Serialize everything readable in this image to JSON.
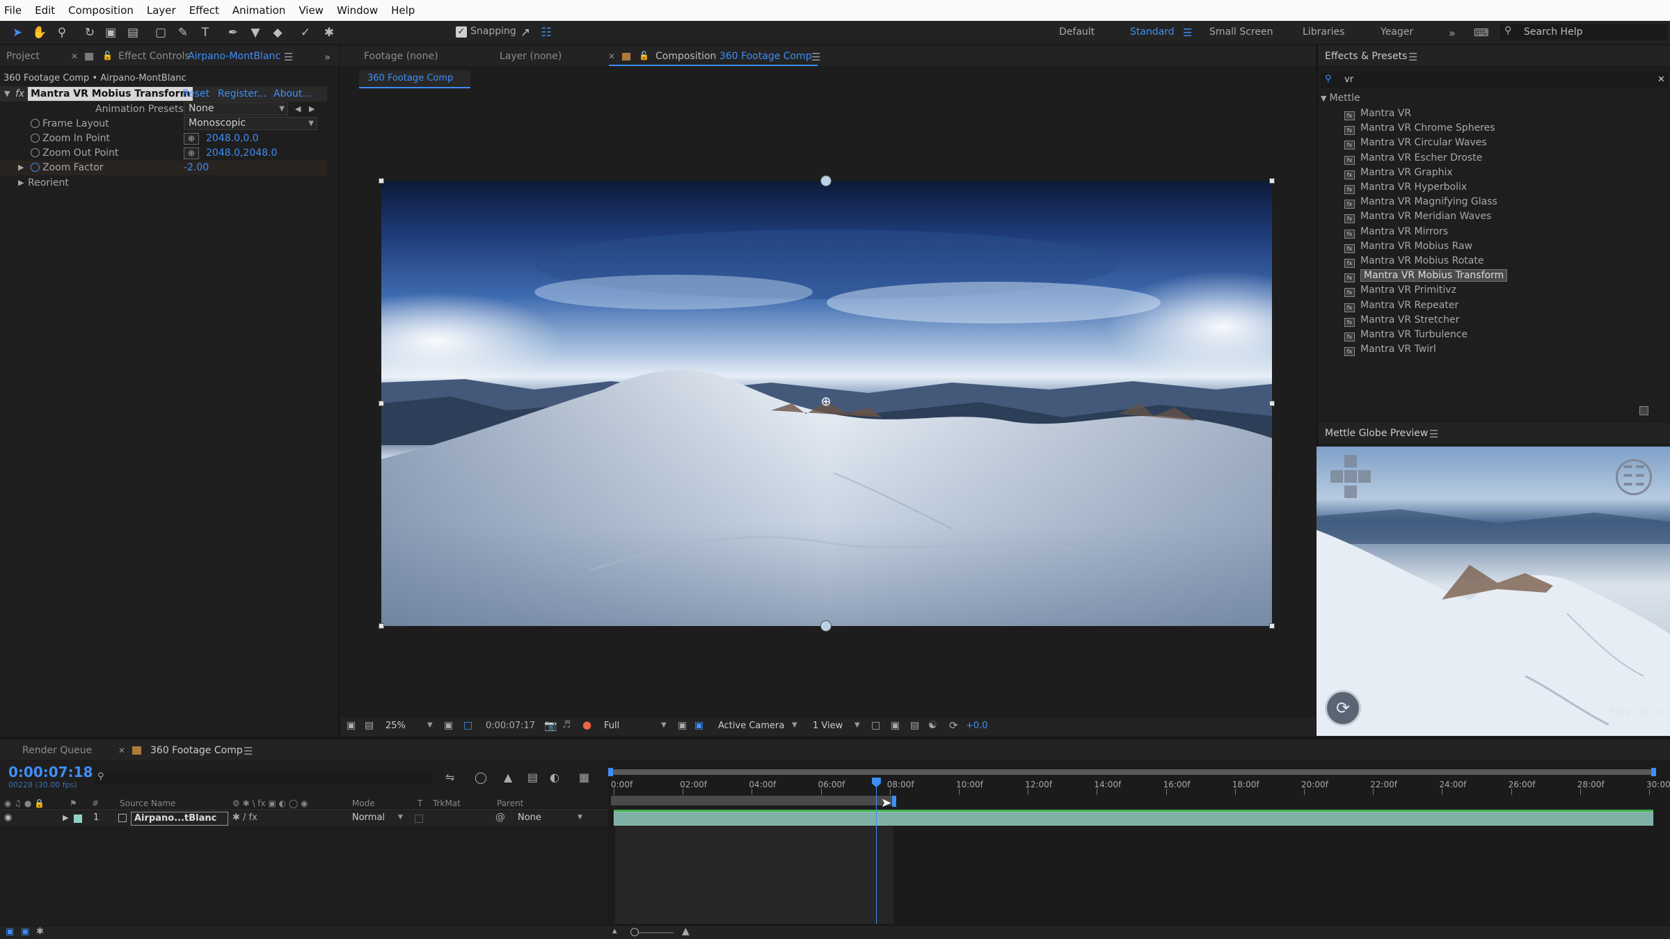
{
  "menu": [
    "File",
    "Edit",
    "Composition",
    "Layer",
    "Effect",
    "Animation",
    "View",
    "Window",
    "Help"
  ],
  "toolbar": {
    "snapping_label": "Snapping",
    "workspaces": [
      "Default",
      "Standard",
      "Small Screen",
      "Libraries",
      "Yeager"
    ],
    "active_workspace": "Standard",
    "search_placeholder": "Search Help"
  },
  "left_panel": {
    "tab_project": "Project",
    "tab_effect_controls": "Effect Controls",
    "layer_name": "Airpano-MontBlanc",
    "breadcrumb": "360 Footage Comp • Airpano-MontBlanc",
    "effect_name": "Mantra VR Mobius Transform",
    "reset": "Reset",
    "register": "Register...",
    "about": "About...",
    "animation_presets_label": "Animation Presets:",
    "animation_presets_value": "None",
    "frame_layout_label": "Frame Layout",
    "frame_layout_value": "Monoscopic",
    "zoom_in_label": "Zoom In Point",
    "zoom_in_value": "2048.0,0.0",
    "zoom_out_label": "Zoom Out Point",
    "zoom_out_value": "2048.0,2048.0",
    "zoom_factor_label": "Zoom Factor",
    "zoom_factor_value": "-2.00",
    "reorient_label": "Reorient"
  },
  "viewer": {
    "tab_footage": "Footage (none)",
    "tab_layer": "Layer (none)",
    "tab_composition_prefix": "Composition",
    "comp_name": "360 Footage Comp",
    "subtab": "360 Footage Comp",
    "zoom": "25%",
    "timecode": "0:00:07:17",
    "resolution": "Full",
    "camera": "Active Camera",
    "views": "1 View",
    "exposure": "+0.0"
  },
  "effects_presets": {
    "title": "Effects & Presets",
    "search_value": "vr",
    "category": "Mettle",
    "items": [
      "Mantra VR",
      "Mantra VR Chrome Spheres",
      "Mantra VR Circular Waves",
      "Mantra VR Escher Droste",
      "Mantra VR Graphix",
      "Mantra VR Hyperbolix",
      "Mantra VR Magnifying Glass",
      "Mantra VR Meridian Waves",
      "Mantra VR Mirrors",
      "Mantra VR Mobius Raw",
      "Mantra VR Mobius Rotate",
      "Mantra VR Mobius Transform",
      "Mantra VR Primitivz",
      "Mantra VR Repeater",
      "Mantra VR Stretcher",
      "Mantra VR Turbulence",
      "Mantra VR Twirl"
    ],
    "selected_item": "Mantra VR Mobius Transform"
  },
  "globe_preview": {
    "title": "Mettle Globe Preview",
    "fov": "FOV: 90.0"
  },
  "timeline": {
    "tab_render_queue": "Render Queue",
    "tab_comp": "360 Footage Comp",
    "timecode": "0:00:07:18",
    "frame_info": "00228 (30.00 fps)",
    "columns": {
      "source_name": "Source Name",
      "mode": "Mode",
      "t": "T",
      "trkmat": "TrkMat",
      "parent": "Parent"
    },
    "layer": {
      "number": "1",
      "name": "Airpano...tBlanc",
      "mode": "Normal",
      "parent": "None"
    },
    "ruler_labels": [
      "0:00f",
      "02:00f",
      "04:00f",
      "06:00f",
      "08:00f",
      "10:00f",
      "12:00f",
      "14:00f",
      "16:00f",
      "18:00f",
      "20:00f",
      "22:00f",
      "24:00f",
      "26:00f",
      "28:00f",
      "30:00f"
    ],
    "current_time_seconds": 7.6,
    "duration_seconds": 30
  },
  "colors": {
    "accent": "#3e8ef7",
    "track_bar": "#7fb0a5",
    "panel_bg": "#1d1d1d"
  }
}
